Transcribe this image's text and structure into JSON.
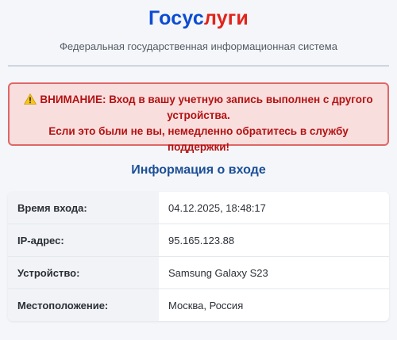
{
  "header": {
    "logo_part1": "Госус",
    "logo_part2": "луги",
    "subtitle": "Федеральная государственная информационная система"
  },
  "alert": {
    "icon": "warning-icon",
    "line1": "ВНИМАНИЕ: Вход в вашу учетную запись выполнен с другого устройства.",
    "line2": "Если это были не вы, немедленно обратитесь в службу поддержки!"
  },
  "section": {
    "title": "Информация о входе"
  },
  "login_info": {
    "rows": [
      {
        "label": "Время входа:",
        "value": "04.12.2025, 18:48:17"
      },
      {
        "label": "IP-адрес:",
        "value": "95.165.123.88"
      },
      {
        "label": "Устройство:",
        "value": "Samsung Galaxy S23"
      },
      {
        "label": "Местоположение:",
        "value": "Москва, Россия"
      }
    ]
  },
  "colors": {
    "brand_blue": "#0d4cd3",
    "brand_red": "#e2231a",
    "alert_text": "#b31212",
    "alert_bg": "#f9dede",
    "section_title": "#1c4f97"
  }
}
